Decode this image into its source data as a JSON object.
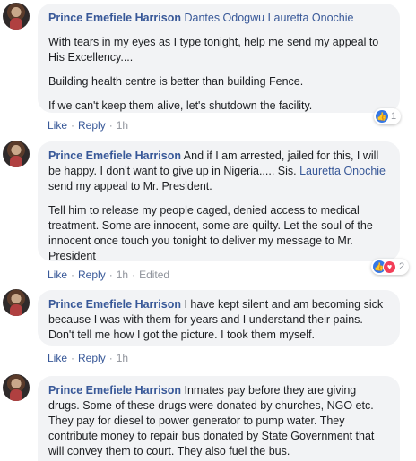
{
  "comments": [
    {
      "author": "Prince Emefiele Harrison",
      "mentions": "Dantes Odogwu Lauretta Onochie",
      "paragraphs": [
        "With tears in my eyes as I type tonight, help me send my appeal to His Excellency....",
        "Building health centre is better than building Fence.",
        "If we can't keep them alive, let's shutdown the facility."
      ],
      "like": "Like",
      "reply": "Reply",
      "time": "1h",
      "reactions": {
        "count": "1",
        "icons": [
          "like-icon"
        ]
      }
    },
    {
      "author": "Prince Emefiele Harrison",
      "text_before_mention": "And if I am arrested, jailed for this, I will be happy. I don't want to give up in Nigeria..... Sis.",
      "mention": "Lauretta Onochie",
      "text_after_mention": "send my appeal to Mr. President.",
      "paragraphs": [
        "Tell him to release my people caged, denied access to medical treatment. Some are innocent, some are quilty. Let the soul of the innocent once touch you tonight to deliver my message to Mr. President"
      ],
      "like": "Like",
      "reply": "Reply",
      "time": "1h",
      "edited": "Edited",
      "reactions": {
        "count": "2",
        "icons": [
          "like-icon",
          "love-icon"
        ]
      }
    },
    {
      "author": "Prince Emefiele Harrison",
      "text": "I have kept silent and am becoming sick because I was with them for years and I understand their pains. Don't tell me how I got the picture. I took them myself.",
      "like": "Like",
      "reply": "Reply",
      "time": "1h"
    },
    {
      "author": "Prince Emefiele Harrison",
      "text": "Inmates pay before they are giving drugs. Some of these drugs were donated by churches, NGO etc. They pay for diesel to power generator to pump water. They contribute money to repair bus donated by State Government that will convey them to court. They also fuel the bus."
    }
  ],
  "colors": {
    "link": "#385898",
    "bubble": "#f2f3f5",
    "like_blue": "#3578e5",
    "love_red": "#f33e58"
  }
}
